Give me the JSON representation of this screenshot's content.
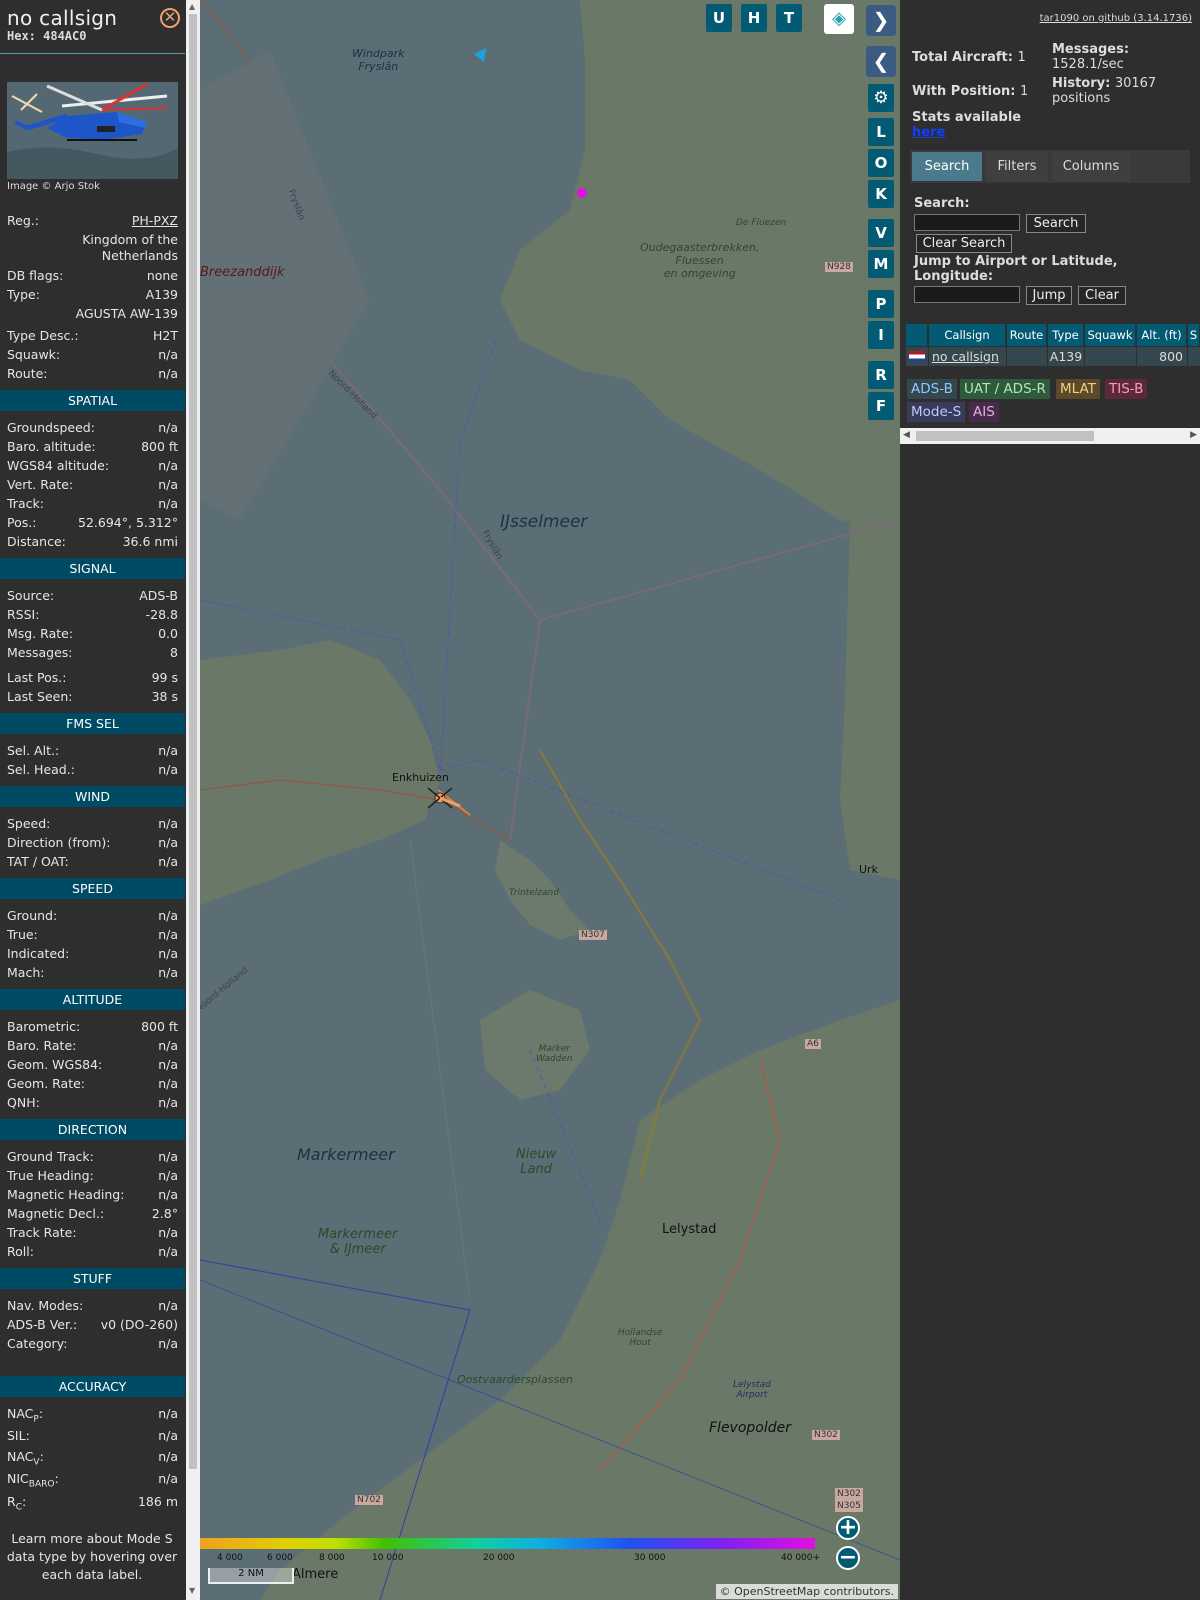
{
  "infoblock": {
    "callsign": "no callsign",
    "hex": "Hex: 484AC0",
    "photo_credit": "Image © Arjo Stok",
    "reg_label": "Reg.:",
    "reg": "PH-PXZ",
    "country_line1": "Kingdom of the",
    "country_line2": "Netherlands",
    "dbflags_label": "DB flags:",
    "dbflags": "none",
    "type_label": "Type:",
    "type": "A139",
    "type_full": "AGUSTA AW-139",
    "typedesc_label": "Type Desc.:",
    "typedesc": "H2T",
    "squawk_label": "Squawk:",
    "squawk": "n/a",
    "route_label": "Route:",
    "route": "n/a",
    "sections": {
      "spatial": "SPATIAL",
      "signal": "SIGNAL",
      "fms": "FMS SEL",
      "wind": "WIND",
      "speed": "SPEED",
      "altitude": "ALTITUDE",
      "direction": "DIRECTION",
      "stuff": "STUFF",
      "accuracy": "ACCURACY"
    },
    "spatial": [
      {
        "k": "Groundspeed:",
        "v": "n/a"
      },
      {
        "k": "Baro. altitude:",
        "v": "800 ft"
      },
      {
        "k": "WGS84 altitude:",
        "v": "n/a"
      },
      {
        "k": "Vert. Rate:",
        "v": "n/a"
      },
      {
        "k": "Track:",
        "v": "n/a"
      },
      {
        "k": "Pos.:",
        "v": "52.694°, 5.312°"
      },
      {
        "k": "Distance:",
        "v": "36.6 nmi"
      }
    ],
    "signal": [
      {
        "k": "Source:",
        "v": "ADS-B"
      },
      {
        "k": "RSSI:",
        "v": "-28.8"
      },
      {
        "k": "Msg. Rate:",
        "v": "0.0"
      },
      {
        "k": "Messages:",
        "v": "8"
      },
      {
        "k": "Last Pos.:",
        "v": "99 s"
      },
      {
        "k": "Last Seen:",
        "v": "38 s"
      }
    ],
    "fms": [
      {
        "k": "Sel. Alt.:",
        "v": "n/a"
      },
      {
        "k": "Sel. Head.:",
        "v": "n/a"
      }
    ],
    "wind": [
      {
        "k": "Speed:",
        "v": "n/a"
      },
      {
        "k": "Direction (from):",
        "v": "n/a"
      },
      {
        "k": "TAT / OAT:",
        "v": "n/a"
      }
    ],
    "speed": [
      {
        "k": "Ground:",
        "v": "n/a"
      },
      {
        "k": "True:",
        "v": "n/a"
      },
      {
        "k": "Indicated:",
        "v": "n/a"
      },
      {
        "k": "Mach:",
        "v": "n/a"
      }
    ],
    "altitude": [
      {
        "k": "Barometric:",
        "v": "800 ft"
      },
      {
        "k": "Baro. Rate:",
        "v": "n/a"
      },
      {
        "k": "Geom. WGS84:",
        "v": "n/a"
      },
      {
        "k": "Geom. Rate:",
        "v": "n/a"
      },
      {
        "k": "QNH:",
        "v": "n/a"
      }
    ],
    "direction": [
      {
        "k": "Ground Track:",
        "v": "n/a"
      },
      {
        "k": "True Heading:",
        "v": "n/a"
      },
      {
        "k": "Magnetic Heading:",
        "v": "n/a"
      },
      {
        "k": "Magnetic Decl.:",
        "v": "2.8°"
      },
      {
        "k": "Track Rate:",
        "v": "n/a"
      },
      {
        "k": "Roll:",
        "v": "n/a"
      }
    ],
    "stuff": [
      {
        "k": "Nav. Modes:",
        "v": "n/a"
      },
      {
        "k": "ADS-B Ver.:",
        "v": "v0 (DO-260)"
      },
      {
        "k": "Category:",
        "v": "n/a"
      }
    ],
    "accuracy": [
      {
        "k": "NAC",
        "sub": "P",
        "v": "n/a"
      },
      {
        "k": "SIL:",
        "sub": "",
        "v": "n/a"
      },
      {
        "k": "NAC",
        "sub": "V",
        "v": "n/a"
      },
      {
        "k": "NIC",
        "sub": "BARO",
        "v": "n/a"
      },
      {
        "k": "R",
        "sub": "C",
        "v": "186 m"
      }
    ],
    "footer_line1": "Learn more about Mode S",
    "footer_line2": "data type by hovering over",
    "footer_line3": "each data label."
  },
  "map": {
    "buttons_top": [
      "U",
      "H",
      "T"
    ],
    "buttons_side": [
      "L",
      "O",
      "K",
      "V",
      "M",
      "P",
      "I",
      "R",
      "F"
    ],
    "labels": {
      "windpark": "Windpark",
      "windpark2": "Fryslân",
      "breezanddijk": "Breezanddijk",
      "frysian1": "Fryslân",
      "frysian2": "Fryslân",
      "noordholland1": "Noord-Holland",
      "noordholland2": "Noord-Holland",
      "ijsselmeer": "IJsselmeer",
      "oudega1": "Oudegaasterbrekken,",
      "oudega2": "Fluessen",
      "oudega3": "en omgeving",
      "defluezen": "De Fluezen",
      "n928": "N928",
      "enkhuizen": "Enkhuizen",
      "urk": "Urk",
      "trintelzand": "Trintelzand",
      "n307": "N307",
      "marker1": "Marker",
      "marker2": "Wadden",
      "a6": "A6",
      "markermeer": "Markermeer",
      "nieuw1": "Nieuw",
      "nieuw2": "Land",
      "lelystad": "Lelystad",
      "mij1": "Markermeer",
      "mij2": "& IJmeer",
      "hollandse1": "Hollandse",
      "hollandse2": "Hout",
      "lelyair1": "Lelystad",
      "lelyair2": "Airport",
      "oostvaarders": "Oostvaardersplassen",
      "flevopolder": "Flevopolder",
      "n302": "N302",
      "n302b": "N302",
      "n305": "N305",
      "n702": "N702",
      "almere": "Almere"
    },
    "altitude_ticks": [
      "4 000",
      "6 000",
      "8 000",
      "10 000",
      "20 000",
      "30 000",
      "40 000+"
    ],
    "scale": "2 NM",
    "attribution": "© OpenStreetMap contributors."
  },
  "sidebar": {
    "github": "tar1090 on github (3.14.1736)",
    "total_label": "Total Aircraft:",
    "total": "1",
    "withpos_label": "With Position:",
    "withpos": "1",
    "messages_label": "Messages:",
    "messages": "1528.1/sec",
    "history_label": "History:",
    "history": "30167",
    "history_unit": "positions",
    "stats_label": "Stats available",
    "stats_link": "here",
    "tabs": [
      "Search",
      "Filters",
      "Columns"
    ],
    "search_label": "Search:",
    "search_button": "Search",
    "clear_search_button": "Clear Search",
    "jump_label1": "Jump to Airport or Latitude,",
    "jump_label2": "Longitude:",
    "jump_button": "Jump",
    "clear_button": "Clear",
    "table_headers": [
      "Callsign",
      "Route",
      "Type",
      "Squawk",
      "Alt. (ft)",
      "S"
    ],
    "table_row": {
      "callsign": "no callsign",
      "route": "",
      "type": "A139",
      "squawk": "",
      "alt": "800"
    },
    "chips": [
      "ADS-B",
      "UAT / ADS-R",
      "MLAT",
      "TIS-B",
      "Mode-S",
      "AIS"
    ]
  }
}
